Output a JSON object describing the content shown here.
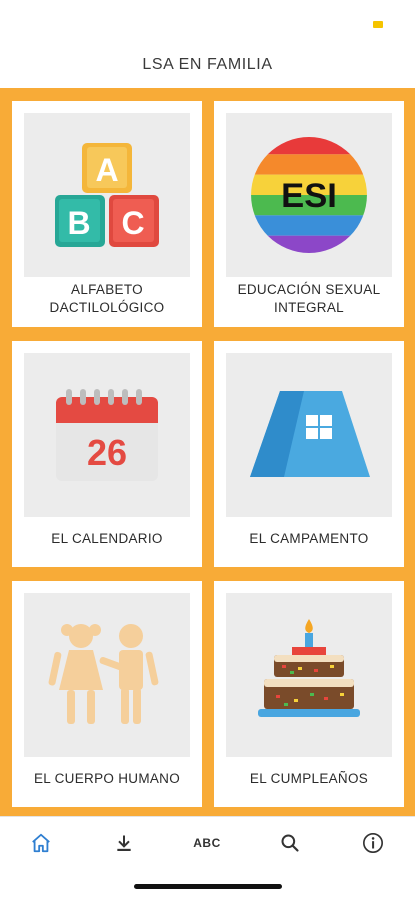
{
  "app": {
    "title": "LSA EN FAMILIA"
  },
  "categories": [
    {
      "label": "ALFABETO\nDACTILOLÓGICO",
      "icon": "abc-blocks-icon",
      "blocks": [
        "A",
        "B",
        "C"
      ]
    },
    {
      "label": "EDUCACIÓN SEXUAL\nINTEGRAL",
      "icon": "esi-rainbow-icon",
      "badge": "ESI"
    },
    {
      "label": "EL CALENDARIO",
      "icon": "calendar-icon",
      "day": "26"
    },
    {
      "label": "EL CAMPAMENTO",
      "icon": "tent-icon"
    },
    {
      "label": "EL CUERPO HUMANO",
      "icon": "children-icon"
    },
    {
      "label": "EL CUMPLEAÑOS",
      "icon": "birthday-cake-icon"
    }
  ],
  "bottom_nav": {
    "items": [
      {
        "name": "home",
        "icon": "home-icon",
        "active": true
      },
      {
        "name": "download",
        "icon": "download-icon"
      },
      {
        "name": "alphabet",
        "text": "ABC"
      },
      {
        "name": "search",
        "icon": "search-icon"
      },
      {
        "name": "info",
        "icon": "info-icon"
      }
    ]
  },
  "colors": {
    "accent": "#f8ab37",
    "tile_bg": "#ececec",
    "active_nav": "#2f7fd1"
  }
}
